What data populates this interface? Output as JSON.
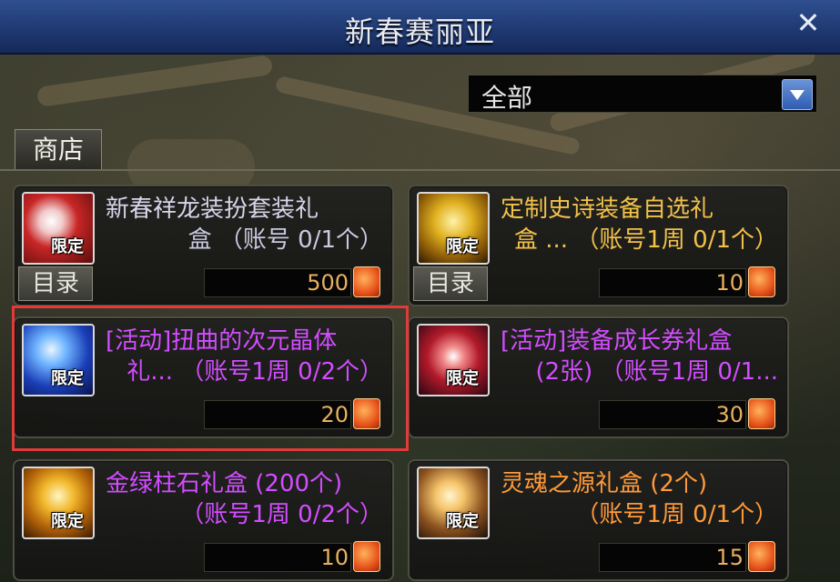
{
  "window": {
    "title": "新春赛丽亚",
    "close_glyph": "✕"
  },
  "filter": {
    "selected": "全部"
  },
  "tabs": [
    {
      "label": "商店"
    }
  ],
  "catalog_label": "目录",
  "items": [
    {
      "name": "新春祥龙装扮套装礼",
      "sub": "盒      （账号 0/1个）",
      "price": "500",
      "badge": "限定",
      "name_color": "white",
      "has_catalog": true
    },
    {
      "name": "定制史诗装备自选礼",
      "sub": "盒 ...  （账号1周 0/1个）",
      "price": "10",
      "badge": "限定",
      "name_color": "gold",
      "has_catalog": true
    },
    {
      "name": "[活动]扭曲的次元晶体",
      "sub": "礼...  （账号1周 0/2个）",
      "price": "20",
      "badge": "限定",
      "name_color": "purple",
      "has_catalog": false
    },
    {
      "name": "[活动]装备成长券礼盒",
      "sub": "(2张)  （账号1周 0/1...",
      "price": "30",
      "badge": "限定",
      "name_color": "purple",
      "has_catalog": false
    },
    {
      "name": "金绿柱石礼盒 (200个)",
      "sub": "（账号1周 0/2个）",
      "price": "10",
      "badge": "限定",
      "name_color": "purple",
      "has_catalog": false
    },
    {
      "name": "灵魂之源礼盒 (2个)",
      "sub": "（账号1周 0/1个）",
      "price": "15",
      "badge": "限定",
      "name_color": "orange",
      "has_catalog": false
    }
  ],
  "colors": {
    "titlebar": "#1f3a73",
    "highlight_border": "#e03a3a",
    "price_text": "#e8b060"
  },
  "icons": [
    "close-icon",
    "dropdown-arrow-icon",
    "currency-icon",
    "gift-box-icon",
    "treasure-chest-icon",
    "crystal-icon",
    "ticket-icon",
    "gem-icon",
    "soul-icon"
  ]
}
